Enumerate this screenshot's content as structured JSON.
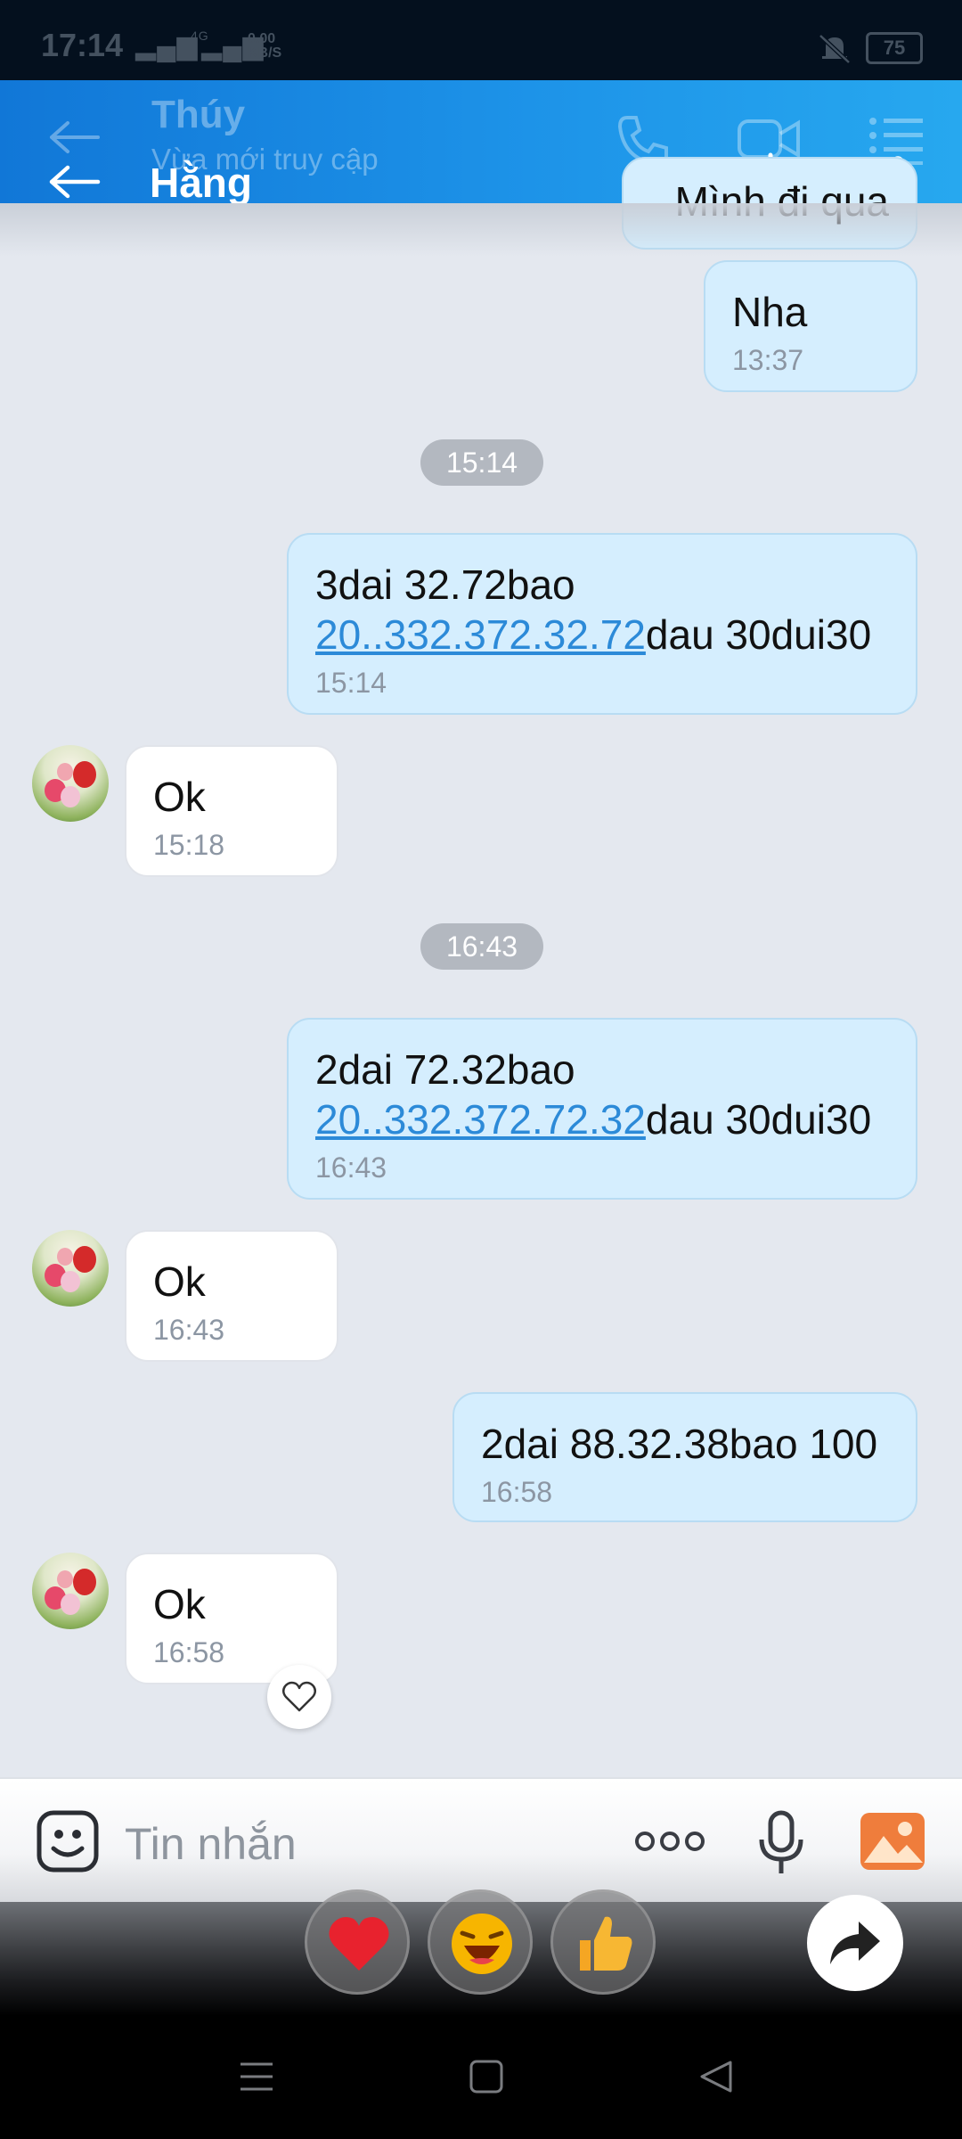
{
  "status_bar": {
    "time": "17:14",
    "signal_1": "ıll",
    "network_speed_value": "0.00",
    "network_speed_unit": "KB/S",
    "lte": "4G",
    "battery": "75"
  },
  "header": {
    "ghost_title": "Thúy",
    "ghost_subtitle": "Vừa mới truy cập",
    "contact_name": "Hằng"
  },
  "messages": [
    {
      "id": "m0",
      "direction": "out",
      "text": "Mình đi qua",
      "time": ""
    },
    {
      "id": "m1",
      "direction": "out",
      "text": "Nha",
      "time": "13:37"
    },
    {
      "id": "d1",
      "type": "date_pill",
      "text": "15:14"
    },
    {
      "id": "m2",
      "direction": "out",
      "line1": "3dai 32.72bao",
      "link": "20..332.372.32.72",
      "after_link": "dau 30dui30",
      "time": "15:14"
    },
    {
      "id": "m3",
      "direction": "in",
      "text": "Ok",
      "time": "15:18"
    },
    {
      "id": "d2",
      "type": "date_pill",
      "text": "16:43"
    },
    {
      "id": "m4",
      "direction": "out",
      "line1": "2dai 72.32bao",
      "link": "20..332.372.72.32",
      "after_link": "dau 30dui30",
      "time": "16:43"
    },
    {
      "id": "m5",
      "direction": "in",
      "text": "Ok",
      "time": "16:43"
    },
    {
      "id": "m6",
      "direction": "out",
      "text": "2dai 88.32.38bao 100",
      "time": "16:58"
    },
    {
      "id": "m7",
      "direction": "in",
      "text": "Ok",
      "time": "16:58"
    }
  ],
  "input": {
    "placeholder": "Tin nhắn"
  },
  "reactions": [
    "heart-icon",
    "laughing-face-icon",
    "thumbs-up-icon"
  ],
  "colors": {
    "header_start": "#1177d7",
    "header_end": "#27a8ef",
    "outgoing_bubble": "#d5eefe",
    "incoming_bubble": "#ffffff",
    "link": "#2c8ad8",
    "background": "#e4e8ef"
  }
}
